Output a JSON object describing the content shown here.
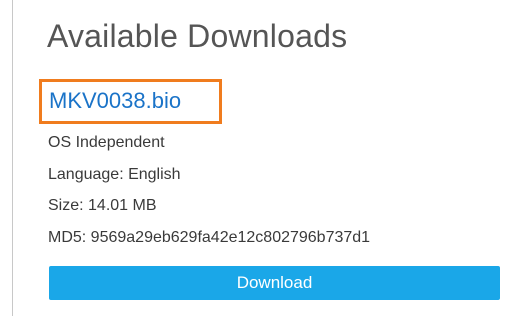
{
  "section": {
    "title": "Available Downloads"
  },
  "file": {
    "name": "MKV0038.bio",
    "os": "OS Independent",
    "language": "Language: English",
    "size": "Size: 14.01 MB",
    "md5": "MD5: 9569a29eb629fa42e12c802796b737d1"
  },
  "actions": {
    "download_label": "Download"
  },
  "colors": {
    "link": "#1a73c8",
    "highlight_box": "#f07c1e",
    "button": "#1aa7e8"
  }
}
